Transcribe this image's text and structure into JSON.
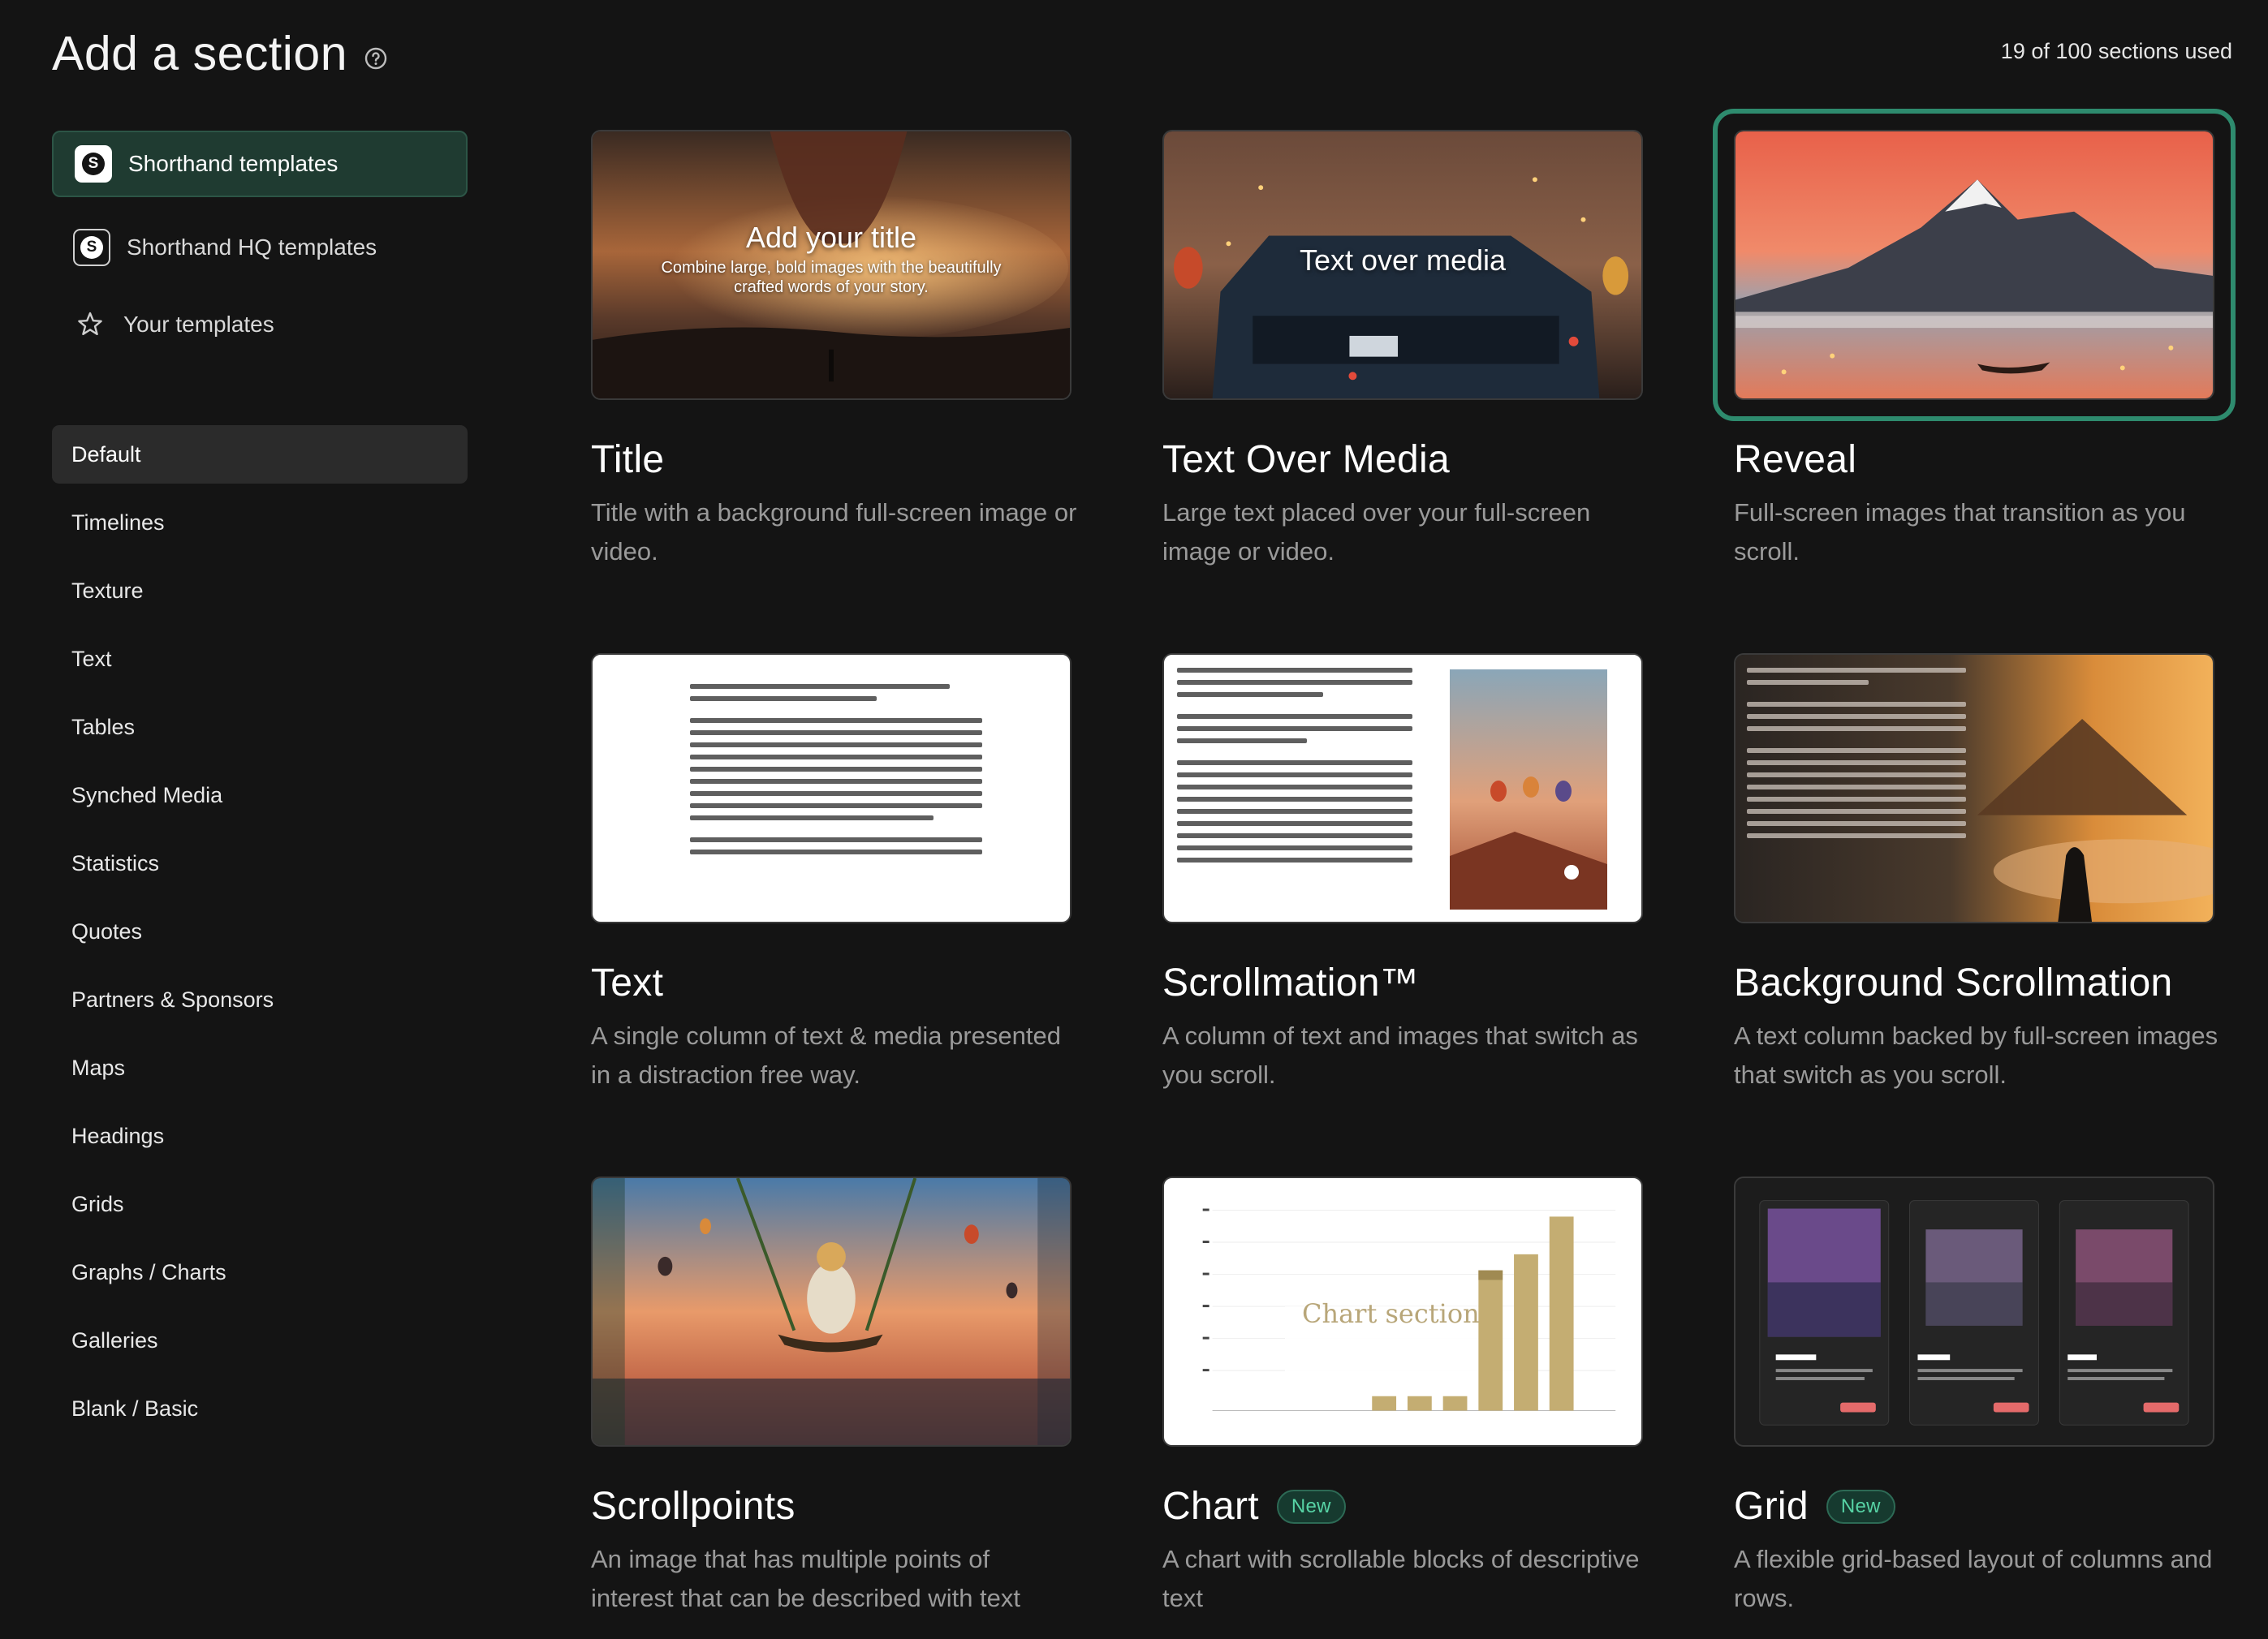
{
  "header": {
    "title": "Add a section",
    "help_icon": "help-circle-icon",
    "usage": "19 of 100 sections used"
  },
  "sources": [
    {
      "label": "Shorthand templates",
      "icon": "shorthand-logo-icon",
      "active": true
    },
    {
      "label": "Shorthand HQ templates",
      "icon": "shorthand-logo-outline-icon",
      "active": false
    },
    {
      "label": "Your templates",
      "icon": "star-icon",
      "active": false
    }
  ],
  "categories": [
    "Default",
    "Timelines",
    "Texture",
    "Text",
    "Tables",
    "Synched Media",
    "Statistics",
    "Quotes",
    "Partners & Sponsors",
    "Maps",
    "Headings",
    "Grids",
    "Graphs / Charts",
    "Galleries",
    "Blank / Basic"
  ],
  "active_category": "Default",
  "cards": [
    {
      "title": "Title",
      "desc": "Title with a background full-screen image or video.",
      "thumb_title": "Add your title",
      "thumb_sub": "Combine large, bold images with the beautifully crafted words of your story."
    },
    {
      "title": "Text Over Media",
      "desc": "Large text placed over your full-screen image or video.",
      "thumb_title": "Text over media"
    },
    {
      "title": "Reveal",
      "desc": "Full-screen images that transition as you scroll.",
      "selected": true
    },
    {
      "title": "Text",
      "desc": "A single column of text & media presented in a distraction free way."
    },
    {
      "title": "Scrollmation™",
      "desc": "A column of text and images that switch as you scroll."
    },
    {
      "title": "Background Scrollmation",
      "desc": "A text column backed by full-screen images that switch as you scroll."
    },
    {
      "title": "Scrollpoints",
      "desc": "An image that has multiple points of interest that can be described with text"
    },
    {
      "title": "Chart",
      "badge": "New",
      "desc": "A chart with scrollable blocks of descriptive text",
      "thumb_title": "Chart section"
    },
    {
      "title": "Grid",
      "badge": "New",
      "desc": "A flexible grid-based layout of columns and rows."
    }
  ],
  "colors": {
    "background": "#141414",
    "accent_green": "#2e8b6e",
    "badge_text": "#57d3a5"
  }
}
